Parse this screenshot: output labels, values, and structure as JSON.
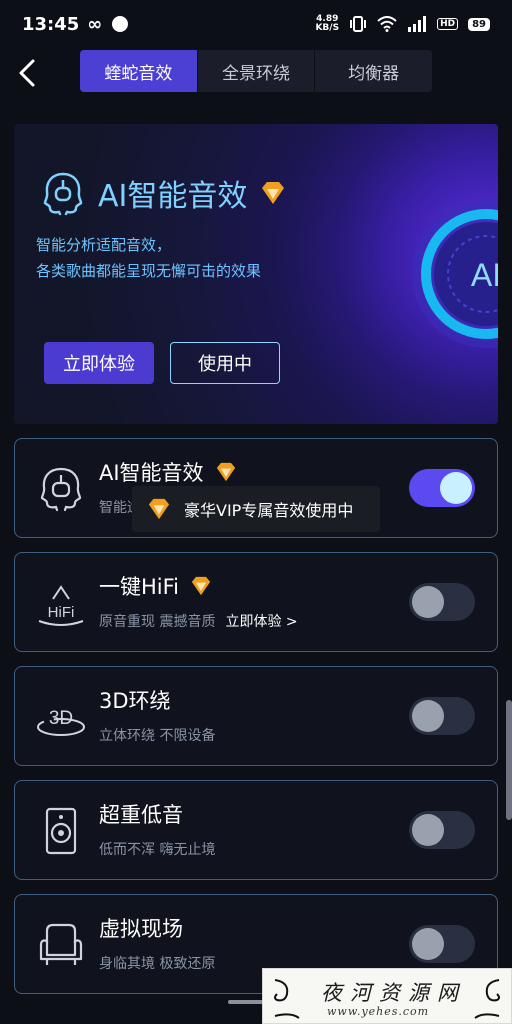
{
  "status": {
    "time": "13:45",
    "infinity": "∞",
    "speed_value": "4.89",
    "speed_unit": "KB/S",
    "hd": "HD",
    "battery": "89"
  },
  "tabs": [
    "蝰蛇音效",
    "全景环绕",
    "均衡器"
  ],
  "active_tab": 0,
  "banner": {
    "title": "AI智能音效",
    "desc_line1": "智能分析适配音效，",
    "desc_line2": "各类歌曲都能呈现无懈可击的效果",
    "try_button": "立即体验",
    "using_button": "使用中",
    "orb_label": "AI"
  },
  "cards": [
    {
      "title": "AI智能音效",
      "subtitle": "智能适配音效增加减，立即体验",
      "link": "",
      "vip": true,
      "enabled": true,
      "icon": "ai-head-icon"
    },
    {
      "title": "一键HiFi",
      "subtitle": "原音重现 震撼音质",
      "link": "立即体验 >",
      "vip": true,
      "enabled": false,
      "icon": "hifi-icon"
    },
    {
      "title": "3D环绕",
      "subtitle": "立体环绕 不限设备",
      "link": "",
      "vip": false,
      "enabled": false,
      "icon": "3d-surround-icon"
    },
    {
      "title": "超重低音",
      "subtitle": "低而不浑 嗨无止境",
      "link": "",
      "vip": false,
      "enabled": false,
      "icon": "speaker-icon"
    },
    {
      "title": "虚拟现场",
      "subtitle": "身临其境 极致还原",
      "link": "",
      "vip": false,
      "enabled": false,
      "icon": "armchair-icon"
    }
  ],
  "icons": {
    "hifi_text": "HiFi",
    "threed_text": "3D"
  },
  "toast": "豪华VIP专属音效使用中",
  "watermark": {
    "main": "夜河资源网",
    "url": "www.yehes.com"
  },
  "colors": {
    "accent": "#4c3fd4",
    "vip_gold": "#f0a020",
    "banner_text": "#7fd1ff",
    "card_border": "#3f5f82"
  }
}
